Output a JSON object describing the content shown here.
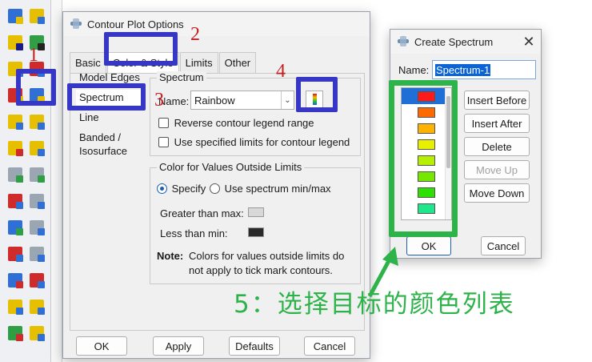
{
  "toolbox": {
    "tools": [
      {
        "name": "tool-row1-a",
        "c1": "#2f6fd6",
        "c2": "#e6c000"
      },
      {
        "name": "tool-row1-b",
        "c1": "#e6c000",
        "c2": "#2f6fd6"
      },
      {
        "name": "tool-row2-a",
        "c1": "#e6c000",
        "c2": "#1a1a8c"
      },
      {
        "name": "tool-row2-b",
        "c1": "#2f9e44",
        "c2": "#222222"
      },
      {
        "name": "tool-row3-a",
        "c1": "#e6c000",
        "c2": "#2f6fd6"
      },
      {
        "name": "tool-row3-b",
        "c1": "#d02b2b",
        "c2": "#2f6fd6"
      },
      {
        "name": "tool-row4-a",
        "c1": "#d02b2b",
        "c2": "#e6c000"
      },
      {
        "name": "tool-row4-b",
        "c1": "#2f6fd6",
        "c2": "#e6c000"
      },
      {
        "name": "tool-row5-a",
        "c1": "#e6c000",
        "c2": "#2f6fd6"
      },
      {
        "name": "tool-row5-b",
        "c1": "#e6c000",
        "c2": "#2f6fd6"
      },
      {
        "name": "tool-row6-a",
        "c1": "#e6c000",
        "c2": "#d02b2b"
      },
      {
        "name": "tool-row6-b",
        "c1": "#e6c000",
        "c2": "#2f6fd6"
      },
      {
        "name": "tool-row7-a",
        "c1": "#9aa6b2",
        "c2": "#2f9e44"
      },
      {
        "name": "tool-row7-b",
        "c1": "#9aa6b2",
        "c2": "#2f9e44"
      },
      {
        "name": "tool-row8-a",
        "c1": "#d02b2b",
        "c2": "#2f6fd6"
      },
      {
        "name": "tool-row8-b",
        "c1": "#9aa6b2",
        "c2": "#2f6fd6"
      },
      {
        "name": "tool-row9-a",
        "c1": "#2f6fd6",
        "c2": "#2f9e44"
      },
      {
        "name": "tool-row9-b",
        "c1": "#9aa6b2",
        "c2": "#2f6fd6"
      },
      {
        "name": "tool-row10-a",
        "c1": "#d02b2b",
        "c2": "#2f6fd6"
      },
      {
        "name": "tool-row10-b",
        "c1": "#9aa6b2",
        "c2": "#2f6fd6"
      },
      {
        "name": "tool-row11-a",
        "c1": "#2f6fd6",
        "c2": "#d02b2b"
      },
      {
        "name": "tool-row11-b",
        "c1": "#d02b2b",
        "c2": "#2f6fd6"
      },
      {
        "name": "tool-row12-a",
        "c1": "#e6c000",
        "c2": "#2f6fd6"
      },
      {
        "name": "tool-row12-b",
        "c1": "#e6c000",
        "c2": "#2f6fd6"
      },
      {
        "name": "tool-row13-a",
        "c1": "#2f9e44",
        "c2": "#d02b2b"
      },
      {
        "name": "tool-row13-b",
        "c1": "#e6c000",
        "c2": "#2f6fd6"
      }
    ]
  },
  "contour_dialog": {
    "title": "Contour Plot Options",
    "tabs": [
      "Basic",
      "Color & Style",
      "Limits",
      "Other"
    ],
    "sidebar": [
      "Model Edges",
      "Spectrum",
      "Line",
      "Banded / Isosurface"
    ],
    "spectrum_group": "Spectrum",
    "name_label": "Name:",
    "name_value": "Rainbow",
    "reverse_label": "Reverse contour legend range",
    "limits_label": "Use specified limits for contour legend",
    "outside_group": "Color for Values Outside Limits",
    "specify_label": "Specify",
    "use_spectrum_label": "Use spectrum min/max",
    "greater_label": "Greater than max:",
    "greater_color": "#d8d8d8",
    "less_label": "Less than min:",
    "less_color": "#2a2a2a",
    "note_label": "Note:",
    "note_text_1": "Colors for values outside limits do",
    "note_text_2": "not apply to tick mark contours.",
    "buttons": {
      "ok": "OK",
      "apply": "Apply",
      "defaults": "Defaults",
      "cancel": "Cancel"
    }
  },
  "spectrum_dialog": {
    "title": "Create Spectrum",
    "name_label": "Name:",
    "name_value": "Spectrum-1",
    "colors": [
      "#ff1a1a",
      "#ff6a00",
      "#ffb300",
      "#e6f000",
      "#b6f000",
      "#76e800",
      "#2ee000",
      "#1ee68a"
    ],
    "buttons": {
      "insert_before": "Insert Before",
      "insert_after": "Insert After",
      "delete": "Delete",
      "move_up": "Move Up",
      "move_down": "Move Down",
      "ok": "OK",
      "cancel": "Cancel"
    }
  },
  "annotations": {
    "n1": "1",
    "n2": "2",
    "n3": "3",
    "n4": "4",
    "caption": "5：选择目标的颜色列表",
    "accent_blue": "#3737c6",
    "accent_red": "#c41e1e",
    "accent_green": "#2db34a"
  }
}
